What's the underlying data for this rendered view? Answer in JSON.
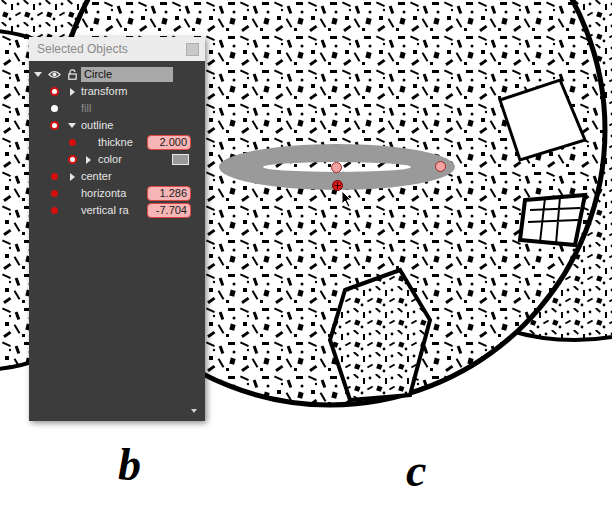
{
  "panel": {
    "title": "Selected Objects"
  },
  "object": {
    "label": "Circle",
    "expanded": true,
    "visible": true,
    "locked": false,
    "selected": true
  },
  "rows": [
    {
      "label": "transform",
      "kind": "group",
      "depth": 0,
      "marker": "ring",
      "expanded": false,
      "disabled": false
    },
    {
      "label": "fill",
      "kind": "prop",
      "depth": 0,
      "marker": "plain",
      "expanded": false,
      "disabled": true
    },
    {
      "label": "outline",
      "kind": "group",
      "depth": 0,
      "marker": "ring",
      "expanded": true,
      "disabled": false
    },
    {
      "label": "thickne",
      "kind": "value",
      "depth": 1,
      "marker": "solid",
      "expanded": false,
      "disabled": false,
      "value": "2.000"
    },
    {
      "label": "color",
      "kind": "color",
      "depth": 1,
      "marker": "ring",
      "expanded": false,
      "disabled": false,
      "color": "#9a9a9a"
    },
    {
      "label": "center",
      "kind": "group",
      "depth": 0,
      "marker": "solid",
      "expanded": false,
      "disabled": false
    },
    {
      "label": "horizonta",
      "kind": "value",
      "depth": 0,
      "marker": "solid",
      "expanded": false,
      "disabled": false,
      "value": "1.286"
    },
    {
      "label": "vertical ra",
      "kind": "value",
      "depth": 0,
      "marker": "solid",
      "expanded": false,
      "disabled": false,
      "value": "-7.704"
    }
  ],
  "handles": [
    {
      "selected": false
    },
    {
      "selected": false
    },
    {
      "selected": true
    }
  ],
  "canvas": {
    "labels": [
      {
        "text": "b"
      },
      {
        "text": "c"
      }
    ]
  }
}
